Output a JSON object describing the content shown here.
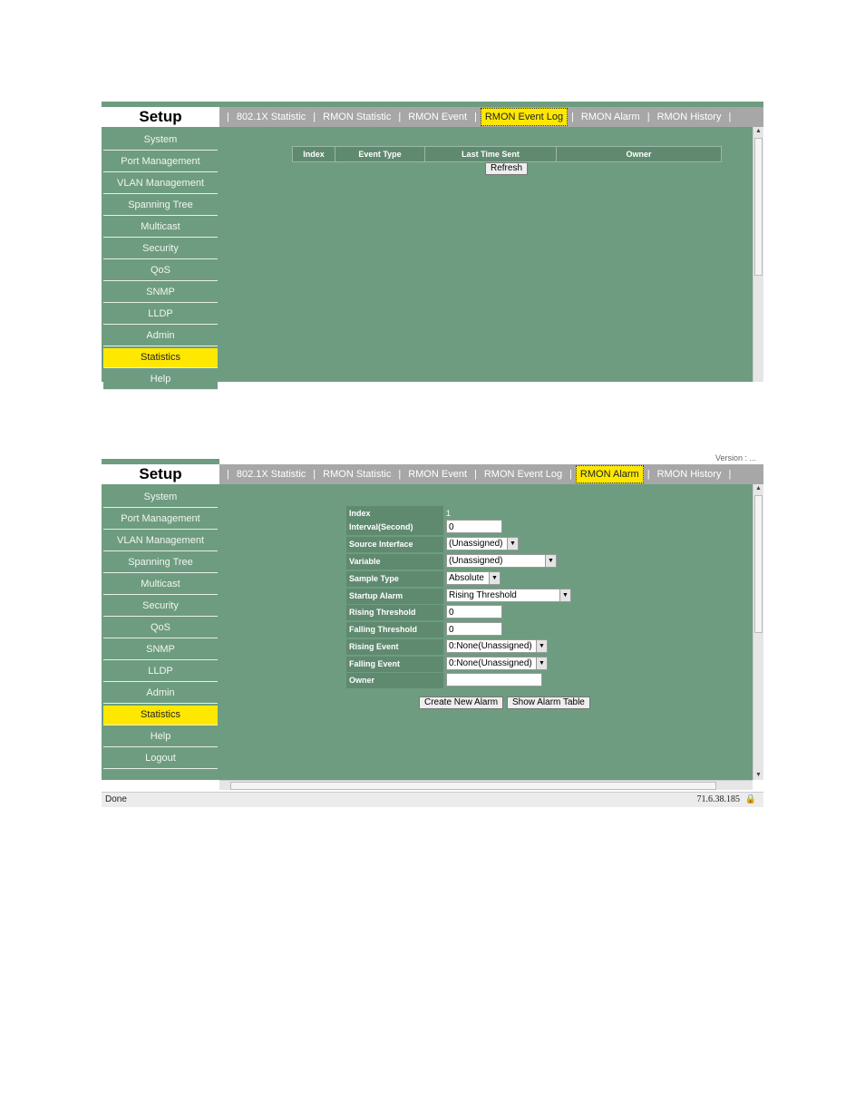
{
  "screens": [
    {
      "setup_title": "Setup",
      "nav": [
        "System",
        "Port Management",
        "VLAN Management",
        "Spanning Tree",
        "Multicast",
        "Security",
        "QoS",
        "SNMP",
        "LLDP",
        "Admin",
        "Statistics",
        "Help"
      ],
      "active_nav": "Statistics",
      "tabs": [
        "802.1X Statistic",
        "RMON Statistic",
        "RMON Event",
        "RMON Event Log",
        "RMON Alarm",
        "RMON History"
      ],
      "active_tab": "RMON Event Log",
      "table_headers": [
        "Index",
        "Event Type",
        "Last Time Sent",
        "Owner"
      ],
      "refresh_label": "Refresh"
    },
    {
      "setup_title": "Setup",
      "version_text": "Version : ...",
      "nav": [
        "System",
        "Port Management",
        "VLAN Management",
        "Spanning Tree",
        "Multicast",
        "Security",
        "QoS",
        "SNMP",
        "LLDP",
        "Admin",
        "Statistics",
        "Help",
        "Logout"
      ],
      "active_nav": "Statistics",
      "tabs": [
        "802.1X Statistic",
        "RMON Statistic",
        "RMON Event",
        "RMON Event Log",
        "RMON Alarm",
        "RMON History"
      ],
      "active_tab": "RMON Alarm",
      "form": {
        "index_label": "Index",
        "index_value": "1",
        "interval_label": "Interval(Second)",
        "interval_value": "0",
        "source_label": "Source Interface",
        "source_value": "(Unassigned)",
        "variable_label": "Variable",
        "variable_value": "(Unassigned)",
        "sample_label": "Sample Type",
        "sample_value": "Absolute",
        "startup_label": "Startup Alarm",
        "startup_value": "Rising Threshold",
        "rising_thr_label": "Rising Threshold",
        "rising_thr_value": "0",
        "falling_thr_label": "Falling Threshold",
        "falling_thr_value": "0",
        "rising_evt_label": "Rising Event",
        "rising_evt_value": "0:None(Unassigned)",
        "falling_evt_label": "Falling Event",
        "falling_evt_value": "0:None(Unassigned)",
        "owner_label": "Owner",
        "owner_value": ""
      },
      "create_label": "Create New Alarm",
      "show_label": "Show Alarm Table",
      "status_left": "Done",
      "status_right": "71.6.38.185"
    }
  ]
}
